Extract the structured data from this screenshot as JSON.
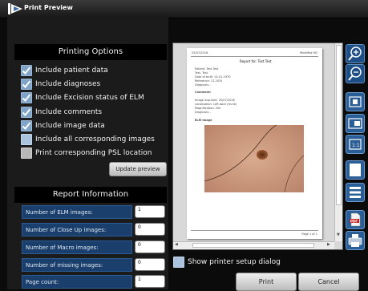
{
  "window": {
    "title": "Print Preview"
  },
  "printing_options": {
    "heading": "Printing Options",
    "options": [
      {
        "label": "Include patient data",
        "state": "checked"
      },
      {
        "label": "Include diagnoses",
        "state": "checked"
      },
      {
        "label": "Include Excision status of ELM",
        "state": "checked"
      },
      {
        "label": "Include comments",
        "state": "checked"
      },
      {
        "label": "Include image data",
        "state": "checked"
      },
      {
        "label": "Include all corresponding images",
        "state": "unchecked"
      },
      {
        "label": "Print corresponding PSL location",
        "state": "disabled"
      }
    ],
    "update_button": "Update preview"
  },
  "report_information": {
    "heading": "Report Information",
    "rows": [
      {
        "label": "Number of ELM images:",
        "value": "1"
      },
      {
        "label": "Number of Close Up images:",
        "value": "0"
      },
      {
        "label": "Number of Macro images:",
        "value": "0"
      },
      {
        "label": "Number of missing images:",
        "value": "0"
      },
      {
        "label": "Page count:",
        "value": "1"
      }
    ]
  },
  "preview": {
    "header_left": "25/07/2016",
    "header_right": "MoleMax HD",
    "report_title": "Report for: Test Test",
    "patient_lines": [
      "Patient: Test Test",
      "Test, Test",
      "Date of birth: 01.01.1970",
      "Reference: 12.2015",
      "Diagnosis: -"
    ],
    "section_comment": "Comment:",
    "comment_lines": [
      "Image acquired: 25/07/2016",
      "Localisation: Left back (trunk)",
      "Magnification: 20x",
      "Diagnosis: -"
    ],
    "section_image": "ELM Image",
    "footer": "Page 1 of 1"
  },
  "side_tools": [
    "zoom-in-icon",
    "zoom-out-icon",
    "fit-page-icon",
    "fit-width-icon",
    "actual-size-icon",
    "single-page-icon",
    "multi-page-icon",
    "pdf-icon",
    "printer-icon"
  ],
  "show_printer_setup": "Show printer setup dialog",
  "buttons": {
    "print": "Print",
    "cancel": "Cancel"
  },
  "colors": {
    "accent_blue": "#1a3f6c",
    "checkbox_blue": "#7fa4c8",
    "skin": "#c79a7e"
  }
}
